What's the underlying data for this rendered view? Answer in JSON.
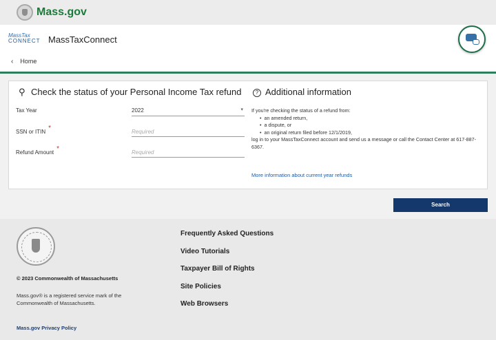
{
  "site": {
    "name": "Mass.gov",
    "seal_icon": "state-seal-icon"
  },
  "app": {
    "logo_line1": "MassTax",
    "logo_line2": "CONNECT",
    "name": "MassTaxConnect",
    "chat_icon": "chat-bubbles-icon"
  },
  "breadcrumb": {
    "back_icon": "chevron-left-icon",
    "label": "Home"
  },
  "form": {
    "title": "Check the status of your Personal Income Tax refund",
    "title_icon": "search-icon",
    "fields": {
      "tax_year": {
        "label": "Tax Year",
        "value": "2022"
      },
      "ssn": {
        "label": "SSN or ITIN",
        "placeholder": "Required",
        "required_mark": "*"
      },
      "refund": {
        "label": "Refund Amount",
        "placeholder": "Required",
        "required_mark": "*"
      }
    },
    "search_label": "Search"
  },
  "additional": {
    "title": "Additional information",
    "title_icon": "question-circle-icon",
    "intro": "If you're checking the status of a refund from:",
    "bullets": [
      "an amended return,",
      "a dispute, or",
      "an original return filed before 12/1/2019,"
    ],
    "outro": "log in to your MassTaxConnect account and send us a message or call the Contact Center at 617-887-6367.",
    "link": "More information about current year refunds"
  },
  "footer": {
    "copyright": "© 2023 Commonwealth of Massachusetts",
    "trademark": "Mass.gov® is a registered service mark of the Commonwealth of Massachusetts.",
    "privacy": "Mass.gov Privacy Policy",
    "links": [
      "Frequently Asked Questions",
      "Video Tutorials",
      "Taxpayer Bill of Rights",
      "Site Policies",
      "Web Browsers"
    ]
  },
  "colors": {
    "brand_green": "#1b7a3a",
    "button_navy": "#14386b",
    "link_blue": "#1e5aa3"
  }
}
